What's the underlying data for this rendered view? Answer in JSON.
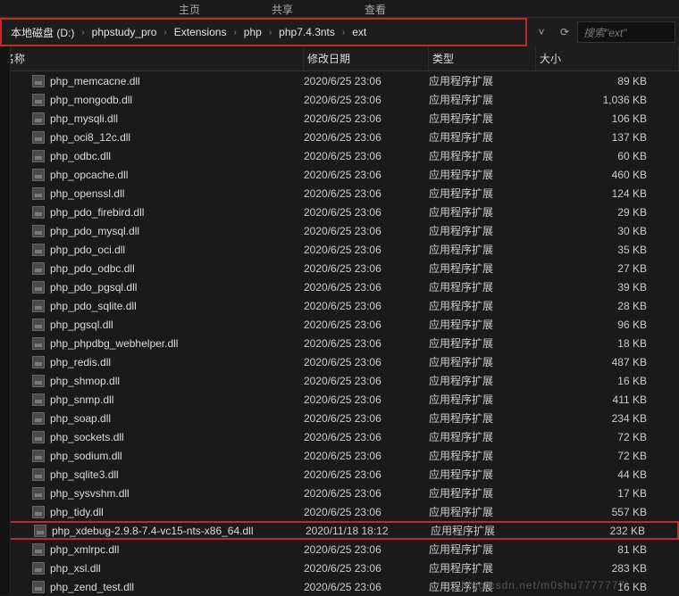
{
  "tabs": {
    "t1": "主页",
    "t2": "共享",
    "t3": "查看"
  },
  "breadcrumb": {
    "items": [
      {
        "label": "本地磁盘 (D:)"
      },
      {
        "label": "phpstudy_pro"
      },
      {
        "label": "Extensions"
      },
      {
        "label": "php"
      },
      {
        "label": "php7.4.3nts"
      },
      {
        "label": "ext"
      }
    ]
  },
  "search": {
    "placeholder": "搜索\"ext\""
  },
  "headers": {
    "name": "名称",
    "date": "修改日期",
    "type": "类型",
    "size": "大小"
  },
  "files": [
    {
      "name": "php_memcacne.dll",
      "date": "2020/6/25 23:06",
      "type": "应用程序扩展",
      "size": "89 KB"
    },
    {
      "name": "php_mongodb.dll",
      "date": "2020/6/25 23:06",
      "type": "应用程序扩展",
      "size": "1,036 KB"
    },
    {
      "name": "php_mysqli.dll",
      "date": "2020/6/25 23:06",
      "type": "应用程序扩展",
      "size": "106 KB"
    },
    {
      "name": "php_oci8_12c.dll",
      "date": "2020/6/25 23:06",
      "type": "应用程序扩展",
      "size": "137 KB"
    },
    {
      "name": "php_odbc.dll",
      "date": "2020/6/25 23:06",
      "type": "应用程序扩展",
      "size": "60 KB"
    },
    {
      "name": "php_opcache.dll",
      "date": "2020/6/25 23:06",
      "type": "应用程序扩展",
      "size": "460 KB"
    },
    {
      "name": "php_openssl.dll",
      "date": "2020/6/25 23:06",
      "type": "应用程序扩展",
      "size": "124 KB"
    },
    {
      "name": "php_pdo_firebird.dll",
      "date": "2020/6/25 23:06",
      "type": "应用程序扩展",
      "size": "29 KB"
    },
    {
      "name": "php_pdo_mysql.dll",
      "date": "2020/6/25 23:06",
      "type": "应用程序扩展",
      "size": "30 KB"
    },
    {
      "name": "php_pdo_oci.dll",
      "date": "2020/6/25 23:06",
      "type": "应用程序扩展",
      "size": "35 KB"
    },
    {
      "name": "php_pdo_odbc.dll",
      "date": "2020/6/25 23:06",
      "type": "应用程序扩展",
      "size": "27 KB"
    },
    {
      "name": "php_pdo_pgsql.dll",
      "date": "2020/6/25 23:06",
      "type": "应用程序扩展",
      "size": "39 KB"
    },
    {
      "name": "php_pdo_sqlite.dll",
      "date": "2020/6/25 23:06",
      "type": "应用程序扩展",
      "size": "28 KB"
    },
    {
      "name": "php_pgsql.dll",
      "date": "2020/6/25 23:06",
      "type": "应用程序扩展",
      "size": "96 KB"
    },
    {
      "name": "php_phpdbg_webhelper.dll",
      "date": "2020/6/25 23:06",
      "type": "应用程序扩展",
      "size": "18 KB"
    },
    {
      "name": "php_redis.dll",
      "date": "2020/6/25 23:06",
      "type": "应用程序扩展",
      "size": "487 KB"
    },
    {
      "name": "php_shmop.dll",
      "date": "2020/6/25 23:06",
      "type": "应用程序扩展",
      "size": "16 KB"
    },
    {
      "name": "php_snmp.dll",
      "date": "2020/6/25 23:06",
      "type": "应用程序扩展",
      "size": "411 KB"
    },
    {
      "name": "php_soap.dll",
      "date": "2020/6/25 23:06",
      "type": "应用程序扩展",
      "size": "234 KB"
    },
    {
      "name": "php_sockets.dll",
      "date": "2020/6/25 23:06",
      "type": "应用程序扩展",
      "size": "72 KB"
    },
    {
      "name": "php_sodium.dll",
      "date": "2020/6/25 23:06",
      "type": "应用程序扩展",
      "size": "72 KB"
    },
    {
      "name": "php_sqlite3.dll",
      "date": "2020/6/25 23:06",
      "type": "应用程序扩展",
      "size": "44 KB"
    },
    {
      "name": "php_sysvshm.dll",
      "date": "2020/6/25 23:06",
      "type": "应用程序扩展",
      "size": "17 KB"
    },
    {
      "name": "php_tidy.dll",
      "date": "2020/6/25 23:06",
      "type": "应用程序扩展",
      "size": "557 KB"
    },
    {
      "name": "php_xdebug-2.9.8-7.4-vc15-nts-x86_64.dll",
      "date": "2020/11/18 18:12",
      "type": "应用程序扩展",
      "size": "232 KB",
      "highlight": true
    },
    {
      "name": "php_xmlrpc.dll",
      "date": "2020/6/25 23:06",
      "type": "应用程序扩展",
      "size": "81 KB"
    },
    {
      "name": "php_xsl.dll",
      "date": "2020/6/25 23:06",
      "type": "应用程序扩展",
      "size": "283 KB"
    },
    {
      "name": "php_zend_test.dll",
      "date": "2020/6/25 23:06",
      "type": "应用程序扩展",
      "size": "16 KB"
    }
  ],
  "watermark": "blog.csdn.net/m0shu7777777"
}
